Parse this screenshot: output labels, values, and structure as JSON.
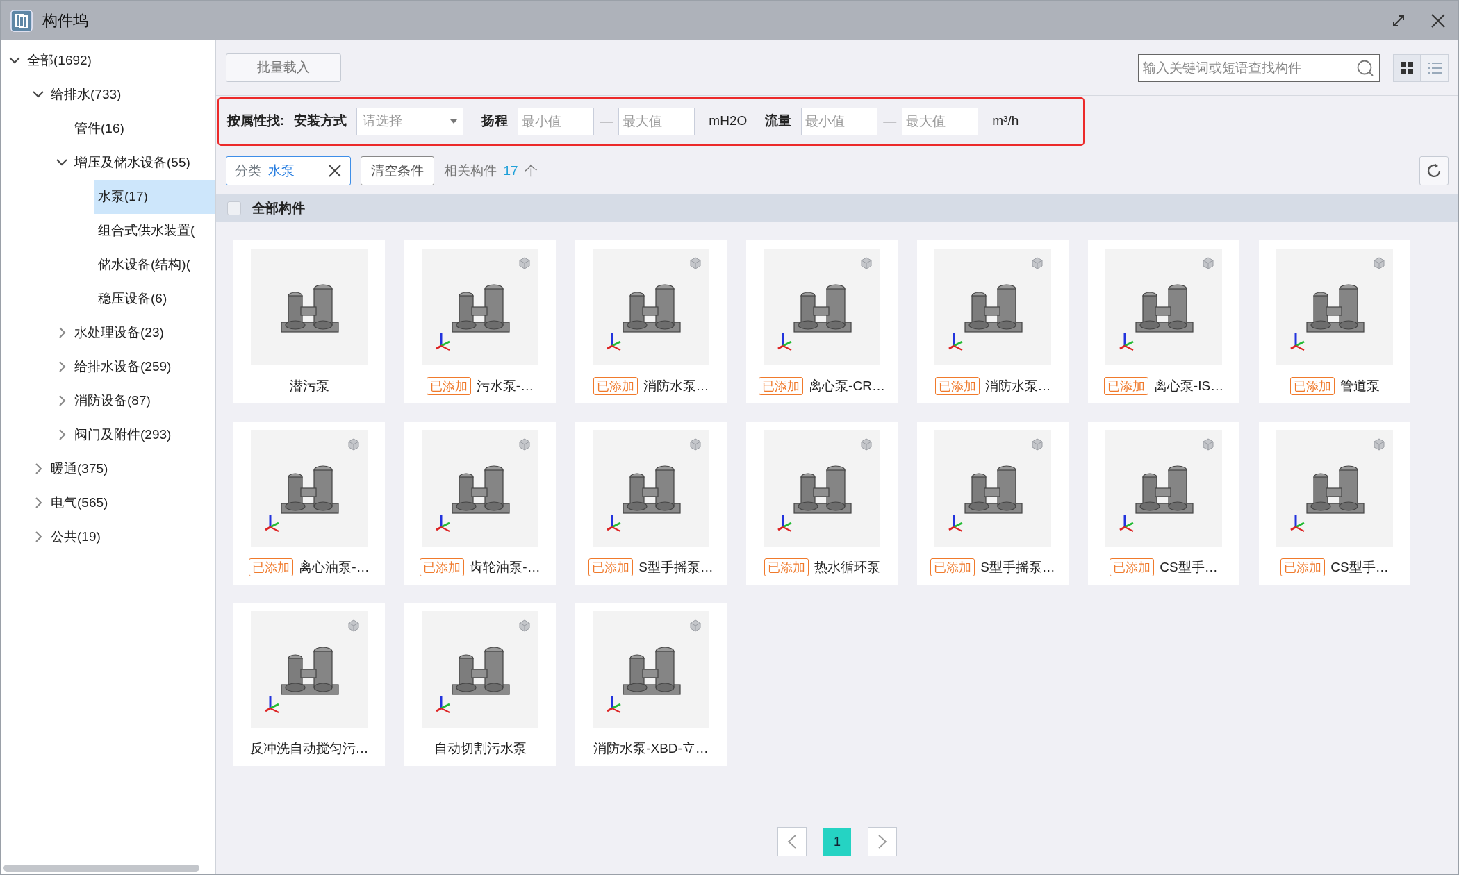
{
  "window": {
    "title": "构件坞"
  },
  "tree": [
    {
      "label": "全部(1692)",
      "expanded": true,
      "selected": false,
      "children": [
        {
          "label": "给排水(733)",
          "expanded": true,
          "selected": false,
          "children": [
            {
              "label": "管件(16)",
              "selected": false
            },
            {
              "label": "增压及储水设备(55)",
              "expanded": true,
              "selected": false,
              "children": [
                {
                  "label": "水泵(17)",
                  "selected": true
                },
                {
                  "label": "组合式供水装置(",
                  "selected": false
                },
                {
                  "label": "储水设备(结构)(",
                  "selected": false
                },
                {
                  "label": "稳压设备(6)",
                  "selected": false
                }
              ]
            },
            {
              "label": "水处理设备(23)",
              "expanded": false,
              "selected": false
            },
            {
              "label": "给排水设备(259)",
              "expanded": false,
              "selected": false
            },
            {
              "label": "消防设备(87)",
              "expanded": false,
              "selected": false
            },
            {
              "label": "阀门及附件(293)",
              "expanded": false,
              "selected": false
            }
          ]
        },
        {
          "label": "暖通(375)",
          "expanded": false,
          "selected": false
        },
        {
          "label": "电气(565)",
          "expanded": false,
          "selected": false
        },
        {
          "label": "公共(19)",
          "expanded": false,
          "selected": false
        }
      ]
    }
  ],
  "toolbar": {
    "batch_button": "批量载入",
    "search": {
      "placeholder": "输入关键词或短语查找构件"
    },
    "views": [
      {
        "kind": "grid",
        "selected": true
      },
      {
        "kind": "list",
        "selected": false
      }
    ]
  },
  "filter": {
    "label": "按属性找:",
    "fields": [
      {
        "kind": "select",
        "label": "安装方式",
        "placeholder": "请选择"
      },
      {
        "kind": "range",
        "label": "扬程",
        "min_placeholder": "最小值",
        "dash": "—",
        "max_placeholder": "最大值",
        "unit": "mH2O"
      },
      {
        "kind": "range",
        "label": "流量",
        "min_placeholder": "最小值",
        "dash": "—",
        "max_placeholder": "最大值",
        "unit": "m³/h"
      }
    ]
  },
  "conditions": {
    "chip": {
      "label": "分类",
      "value": "水泵"
    },
    "clear_button": "清空条件",
    "count_prefix": "相关构件",
    "count": "17",
    "count_suffix": "个"
  },
  "select_all": {
    "label": "全部构件",
    "checked": false
  },
  "cards": [
    {
      "name": "潜污泵",
      "preview_3d": false
    },
    {
      "name": "污水泵-…",
      "badge": "已添加",
      "preview_3d": true
    },
    {
      "name": "消防水泵…",
      "badge": "已添加",
      "preview_3d": true
    },
    {
      "name": "离心泵-CR…",
      "badge": "已添加",
      "preview_3d": true
    },
    {
      "name": "消防水泵…",
      "badge": "已添加",
      "preview_3d": true
    },
    {
      "name": "离心泵-IS…",
      "badge": "已添加",
      "preview_3d": true
    },
    {
      "name": "管道泵",
      "badge": "已添加",
      "preview_3d": true
    },
    {
      "name": "离心油泵-…",
      "badge": "已添加",
      "preview_3d": true
    },
    {
      "name": "齿轮油泵-…",
      "badge": "已添加",
      "preview_3d": true
    },
    {
      "name": "S型手摇泵…",
      "badge": "已添加",
      "preview_3d": true
    },
    {
      "name": "热水循环泵",
      "badge": "已添加",
      "preview_3d": true
    },
    {
      "name": "S型手摇泵…",
      "badge": "已添加",
      "preview_3d": true
    },
    {
      "name": "CS型手…",
      "badge": "已添加",
      "preview_3d": true
    },
    {
      "name": "CS型手…",
      "badge": "已添加",
      "preview_3d": true
    },
    {
      "name": "反冲洗自动搅匀污…",
      "preview_3d": true
    },
    {
      "name": "自动切割污水泵",
      "preview_3d": true
    },
    {
      "name": "消防水泵-XBD-立…",
      "preview_3d": true
    }
  ],
  "pagination": {
    "pages": [
      {
        "label": "1",
        "selected": true
      }
    ]
  }
}
